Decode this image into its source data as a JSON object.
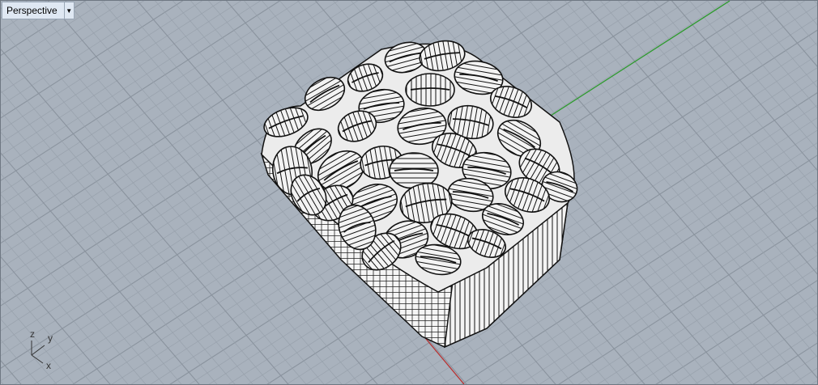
{
  "viewport": {
    "name": "Perspective",
    "menu_icon": "dropdown-triangle-icon"
  },
  "axis_widget": {
    "z_label": "z",
    "y_label": "y",
    "x_label": "x"
  },
  "colors": {
    "background": "#a9b2bd",
    "grid_minor": "#98a1ac",
    "grid_major": "#8a939e",
    "x_axis": "#b83030",
    "y_axis": "#2e9a2e",
    "wire": "#111111",
    "surface": "#f2f2f2"
  },
  "model": {
    "description_icon": "wireframe-bean-bowl-model"
  }
}
